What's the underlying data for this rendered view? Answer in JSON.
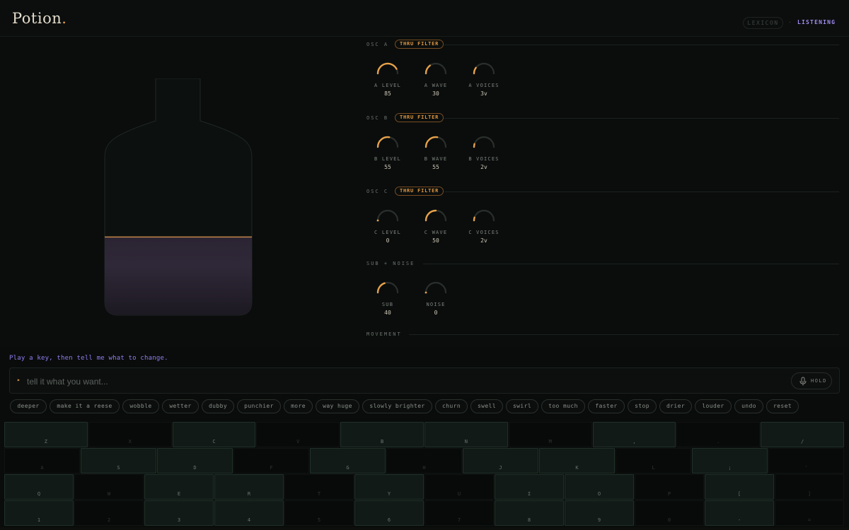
{
  "header": {
    "logo_text": "Potion",
    "logo_dot": ".",
    "lexicon_label": "LEXICON",
    "separator": "·",
    "status": "LISTENING"
  },
  "colors": {
    "accent": "#e8a24a",
    "purple": "#a08cf0",
    "background": "#090c0b"
  },
  "bottle": {
    "fill_level_percent": 33
  },
  "sections": [
    {
      "label": "OSC A",
      "badge": "THRU FILTER",
      "knobs": [
        {
          "label": "A LEVEL",
          "value": "85",
          "level": 0.85
        },
        {
          "label": "A WAVE",
          "value": "30",
          "level": 0.3
        },
        {
          "label": "A VOICES",
          "value": "3v",
          "level": 0.2
        }
      ]
    },
    {
      "label": "OSC B",
      "badge": "THRU FILTER",
      "knobs": [
        {
          "label": "B LEVEL",
          "value": "55",
          "level": 0.55
        },
        {
          "label": "B WAVE",
          "value": "55",
          "level": 0.55
        },
        {
          "label": "B VOICES",
          "value": "2v",
          "level": 0.1
        }
      ]
    },
    {
      "label": "OSC C",
      "badge": "THRU FILTER",
      "knobs": [
        {
          "label": "C LEVEL",
          "value": "0",
          "level": 0.0
        },
        {
          "label": "C WAVE",
          "value": "50",
          "level": 0.5
        },
        {
          "label": "C VOICES",
          "value": "2v",
          "level": 0.1
        }
      ]
    },
    {
      "label": "SUB + NOISE",
      "badge": null,
      "knobs": [
        {
          "label": "SUB",
          "value": "40",
          "level": 0.4
        },
        {
          "label": "NOISE",
          "value": "0",
          "level": 0.0
        }
      ]
    },
    {
      "label": "MOVEMENT",
      "badge": null,
      "knobs": []
    }
  ],
  "prompt": {
    "hint": "Play a key, then tell me what to change.",
    "caret": "▸",
    "placeholder": "tell it what you want...",
    "hold_label": "HOLD",
    "hold_icon": "microphone-icon"
  },
  "chips": [
    "deeper",
    "make it a reese",
    "wobble",
    "wetter",
    "dubby",
    "punchier",
    "more",
    "way huge",
    "slowly brighter",
    "churn",
    "swell",
    "swirl",
    "too much",
    "faster",
    "stop",
    "drier",
    "louder",
    "undo",
    "reset"
  ],
  "keyboard": [
    [
      {
        "k": "Z",
        "on": true
      },
      {
        "k": "X",
        "on": false
      },
      {
        "k": "C",
        "on": true
      },
      {
        "k": "V",
        "on": false
      },
      {
        "k": "B",
        "on": true
      },
      {
        "k": "N",
        "on": true
      },
      {
        "k": "M",
        "on": false
      },
      {
        "k": ",",
        "on": true
      },
      {
        "k": ".",
        "on": false
      },
      {
        "k": "/",
        "on": true
      }
    ],
    [
      {
        "k": "A",
        "on": false
      },
      {
        "k": "S",
        "on": true
      },
      {
        "k": "D",
        "on": true
      },
      {
        "k": "F",
        "on": false
      },
      {
        "k": "G",
        "on": true
      },
      {
        "k": "H",
        "on": false
      },
      {
        "k": "J",
        "on": true
      },
      {
        "k": "K",
        "on": true
      },
      {
        "k": "L",
        "on": false
      },
      {
        "k": ";",
        "on": true
      },
      {
        "k": "'",
        "on": false
      }
    ],
    [
      {
        "k": "Q",
        "on": true
      },
      {
        "k": "W",
        "on": false
      },
      {
        "k": "E",
        "on": true
      },
      {
        "k": "R",
        "on": true
      },
      {
        "k": "T",
        "on": false
      },
      {
        "k": "Y",
        "on": true
      },
      {
        "k": "U",
        "on": false
      },
      {
        "k": "I",
        "on": true
      },
      {
        "k": "O",
        "on": true
      },
      {
        "k": "P",
        "on": false
      },
      {
        "k": "[",
        "on": true
      },
      {
        "k": "]",
        "on": false
      }
    ],
    [
      {
        "k": "1",
        "on": true
      },
      {
        "k": "2",
        "on": false
      },
      {
        "k": "3",
        "on": true
      },
      {
        "k": "4",
        "on": true
      },
      {
        "k": "5",
        "on": false
      },
      {
        "k": "6",
        "on": true
      },
      {
        "k": "7",
        "on": false
      },
      {
        "k": "8",
        "on": true
      },
      {
        "k": "9",
        "on": true
      },
      {
        "k": "0",
        "on": false
      },
      {
        "k": "-",
        "on": true
      },
      {
        "k": "=",
        "on": false
      }
    ]
  ]
}
